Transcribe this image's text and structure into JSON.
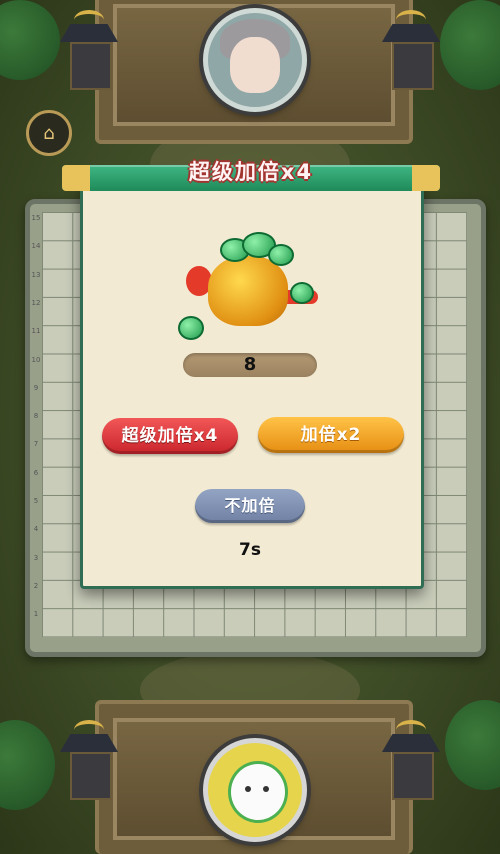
{
  "home": {
    "icon": "home-icon"
  },
  "opponent": {
    "avatar": "opponent-avatar"
  },
  "player": {
    "avatar": "player-avatar"
  },
  "board": {
    "row_labels": [
      "15",
      "14",
      "13",
      "12",
      "11",
      "10",
      "9",
      "8",
      "7",
      "6",
      "5",
      "4",
      "3",
      "2",
      "1"
    ]
  },
  "modal": {
    "title": "超级加倍x4",
    "reward_icon": "treasure-pot-icon",
    "amount": "8",
    "buttons": {
      "super_double": "超级加倍x4",
      "double": "加倍x2",
      "no_double": "不加倍"
    },
    "countdown": "7s"
  },
  "colors": {
    "modal_bg": "#f2ead2",
    "title_bar": "#1f8a5a",
    "btn_red": "#c9252c",
    "btn_orange": "#e58d12",
    "btn_blue": "#6f80a3"
  }
}
